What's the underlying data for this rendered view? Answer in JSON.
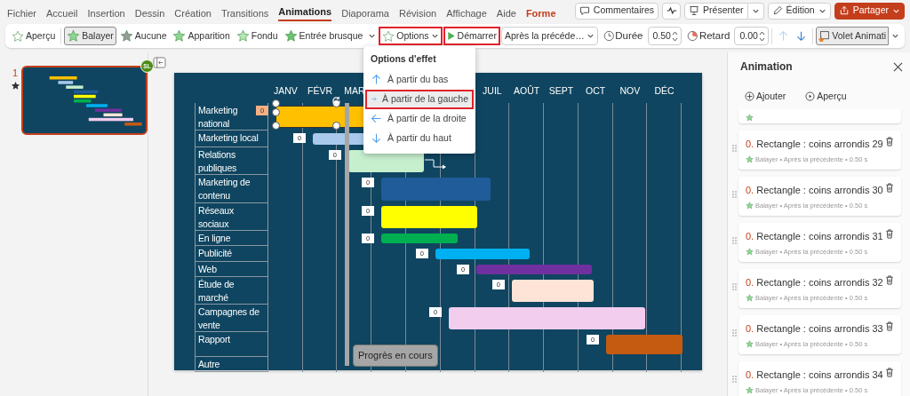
{
  "menu_tabs": [
    {
      "label": "Fichier",
      "selected": false,
      "contextual": false
    },
    {
      "label": "Accueil",
      "selected": false,
      "contextual": false
    },
    {
      "label": "Insertion",
      "selected": false,
      "contextual": false
    },
    {
      "label": "Dessin",
      "selected": false,
      "contextual": false
    },
    {
      "label": "Création",
      "selected": false,
      "contextual": false
    },
    {
      "label": "Transitions",
      "selected": false,
      "contextual": false
    },
    {
      "label": "Animations",
      "selected": true,
      "contextual": false
    },
    {
      "label": "Diaporama",
      "selected": false,
      "contextual": false
    },
    {
      "label": "Révision",
      "selected": false,
      "contextual": false
    },
    {
      "label": "Affichage",
      "selected": false,
      "contextual": false
    },
    {
      "label": "Aide",
      "selected": false,
      "contextual": false
    },
    {
      "label": "Forme",
      "selected": false,
      "contextual": true
    }
  ],
  "header_buttons": [
    {
      "kind": "comments",
      "label": "Commentaires"
    },
    {
      "kind": "activity"
    },
    {
      "kind": "present",
      "label": "Présenter"
    },
    {
      "kind": "edit",
      "label": "Édition"
    },
    {
      "kind": "share",
      "label": "Partager"
    }
  ],
  "ribbon": {
    "preview": "Aperçu",
    "effects": [
      {
        "kind": "wipe",
        "label": "Balayer",
        "selected": true
      },
      {
        "kind": "none",
        "label": "Aucune",
        "selected": false
      },
      {
        "kind": "appear",
        "label": "Apparition",
        "selected": false
      },
      {
        "kind": "fade",
        "label": "Fondu",
        "selected": false
      },
      {
        "kind": "fly",
        "label": "Entrée brusque",
        "selected": false
      }
    ],
    "options": {
      "label": "Options",
      "highlighted": true
    },
    "start": {
      "label": "Démarrer",
      "highlighted": true
    },
    "start_value": "Après la précéde…",
    "duration_label": "Durée",
    "duration_value": "0.50",
    "delay_label": "Retard",
    "delay_value": "0.00",
    "move_earlier": {
      "disabled": true
    },
    "move_later": {
      "disabled": false
    },
    "pane_button": "Volet Animati"
  },
  "effect_options_menu": {
    "title": "Options d'effet",
    "items": [
      {
        "kind": "up",
        "label": "À partir du bas",
        "selected": false
      },
      {
        "kind": "right",
        "label": "À partir de la gauche",
        "selected": true
      },
      {
        "kind": "left",
        "label": "À partir de la droite",
        "selected": false
      },
      {
        "kind": "down",
        "label": "À partir du haut",
        "selected": false
      }
    ]
  },
  "slides_panel": {
    "slides": [
      {
        "number": "1",
        "selected": true,
        "badge": "SL"
      }
    ]
  },
  "slide": {
    "months": [
      "JANV",
      "FÉVR",
      "MAR",
      "JUIL",
      "AOÛT",
      "SEPT",
      "OCT",
      "NOV",
      "DÉC"
    ],
    "tasks": [
      {
        "label": "Marketing national",
        "color": "#ffc000",
        "tag": "0",
        "selected": true
      },
      {
        "label": "Marketing local",
        "color": "#a9c9ec",
        "tag": "0",
        "selected": false
      },
      {
        "label": "Relations publiques",
        "color": "#c6efce",
        "tag": "0",
        "selected": false
      },
      {
        "label": "Marketing de contenu",
        "color": "#1f5c99",
        "tag": "0",
        "selected": false
      },
      {
        "label": "Réseaux sociaux",
        "color": "#ffff00",
        "tag": "0",
        "selected": false
      },
      {
        "label": "En ligne",
        "color": "#00b050",
        "tag": "0",
        "selected": false
      },
      {
        "label": "Publicité",
        "color": "#00b0f0",
        "tag": "0",
        "selected": false
      },
      {
        "label": "Web",
        "color": "#7030a0",
        "tag": "0",
        "selected": false
      },
      {
        "label": "Étude de marché",
        "color": "#fde4d7",
        "tag": "0",
        "selected": false
      },
      {
        "label": "Campagnes de vente",
        "color": "#f2cdee",
        "tag": "0",
        "selected": false
      },
      {
        "label": "Rapport",
        "color": "#c55a11",
        "tag": "0",
        "selected": false
      },
      {
        "label": "Autre"
      }
    ],
    "progress_label": "Progrès en cours"
  },
  "animation_pane": {
    "title": "Animation",
    "add": "Ajouter",
    "preview": "Aperçu",
    "items": [
      {
        "order": "0.",
        "name": "Rectangle : coins arrondis 29",
        "details": "Balayer • Après la précédente • 0.50 s"
      },
      {
        "order": "0.",
        "name": "Rectangle : coins arrondis 30",
        "details": "Balayer • Après la précédente • 0.50 s"
      },
      {
        "order": "0.",
        "name": "Rectangle : coins arrondis 31",
        "details": "Balayer • Après la précédente • 0.50 s"
      },
      {
        "order": "0.",
        "name": "Rectangle : coins arrondis 32",
        "details": "Balayer • Après la précédente • 0.50 s"
      },
      {
        "order": "0.",
        "name": "Rectangle : coins arrondis 33",
        "details": "Balayer • Après la précédente • 0.50 s"
      },
      {
        "order": "0.",
        "name": "Rectangle : coins arrondis 34",
        "details": "Balayer • Après la précédente • 0.50 s"
      }
    ]
  }
}
